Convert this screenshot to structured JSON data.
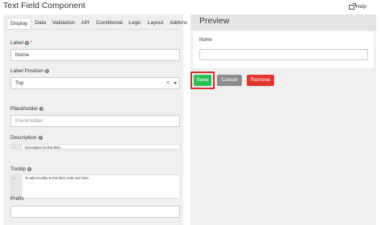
{
  "dialog": {
    "title": "Text Field Component",
    "help": "Help"
  },
  "tabs": [
    "Display",
    "Data",
    "Validation",
    "API",
    "Conditional",
    "Logic",
    "Layout",
    "Addons"
  ],
  "form": {
    "label": {
      "label": "Label",
      "required": "*",
      "value": "Nome"
    },
    "label_position": {
      "label": "Label Position",
      "value": "Top",
      "clear": "×"
    },
    "placeholder": {
      "label": "Placeholder",
      "placeholder": "Placeholder"
    },
    "description": {
      "label": "Description",
      "line": "1",
      "text": "Description for this field."
    },
    "tooltip": {
      "label": "Tooltip",
      "line": "1",
      "text": "To add a tooltip to this field, enter text here."
    },
    "prefix": {
      "label": "Prefix"
    }
  },
  "preview": {
    "title": "Preview",
    "field_label": "Nome",
    "buttons": {
      "save": "Save",
      "cancel": "Cancel",
      "remove": "Remove"
    }
  },
  "colors": {
    "save": "#2ebd59",
    "cancel": "#8c8c8c",
    "remove": "#e0362c",
    "highlight": "#d03030"
  }
}
